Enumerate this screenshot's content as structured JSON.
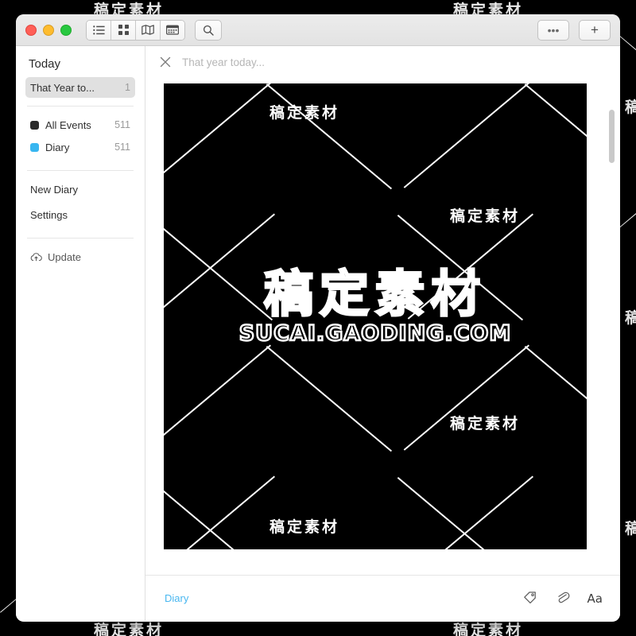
{
  "window": {
    "traffic_lights": [
      "close",
      "minimize",
      "zoom"
    ],
    "toolbar": {
      "view_buttons": [
        {
          "name": "list-view",
          "icon": "list-icon"
        },
        {
          "name": "grid-view",
          "icon": "grid-icon"
        },
        {
          "name": "map-view",
          "icon": "map-icon"
        },
        {
          "name": "calendar-view",
          "icon": "calendar-icon"
        }
      ],
      "search_icon": "search-icon",
      "more_label": "•••",
      "add_label": "+"
    }
  },
  "sidebar": {
    "title": "Today",
    "smart_items": [
      {
        "label": "That Year to...",
        "count": "1",
        "selected": true
      }
    ],
    "calendar_items": [
      {
        "label": "All Events",
        "count": "511",
        "color": "#2b2b2b"
      },
      {
        "label": "Diary",
        "count": "511",
        "color": "#38b6f0"
      }
    ],
    "action_items": [
      {
        "label": "New Diary"
      },
      {
        "label": "Settings"
      }
    ],
    "footer_items": [
      {
        "label": "Update",
        "icon": "cloud-upload-icon"
      }
    ]
  },
  "content": {
    "header": {
      "close_icon": "close-icon",
      "title": "That year today..."
    },
    "photo": {
      "watermark_cn": "稿定素材",
      "watermark_en": "SUCAI.GAODING.COM",
      "background": "#000000"
    },
    "scrollbar": {
      "name": "vertical-scrollbar"
    }
  },
  "bottom_bar": {
    "tag_label": "Diary",
    "tag_color": "#49b7f0",
    "icons": [
      {
        "name": "tag-icon"
      },
      {
        "name": "attachment-icon"
      },
      {
        "name": "font-icon",
        "label": "Aa"
      }
    ]
  },
  "page_watermark": {
    "text": "稿定素材"
  }
}
